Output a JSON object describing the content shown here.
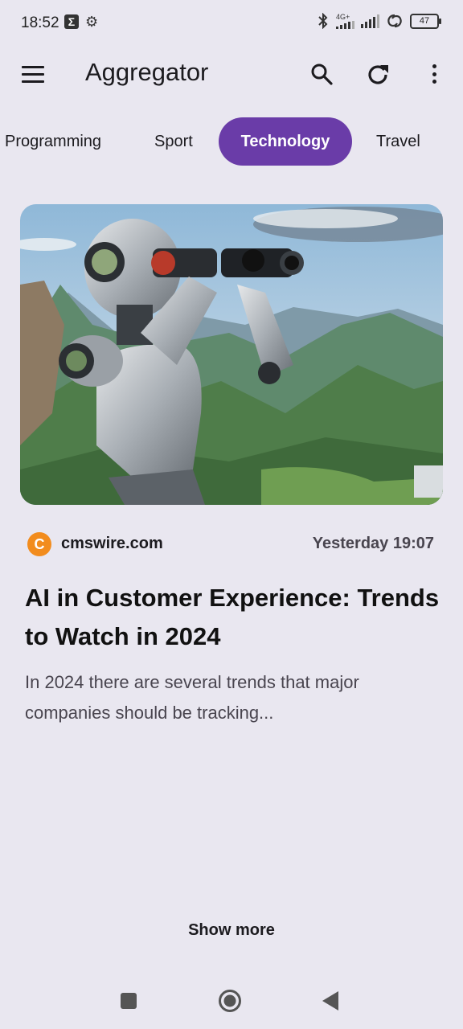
{
  "status_bar": {
    "time": "18:52",
    "network": "4G+",
    "battery": "47"
  },
  "app_bar": {
    "title": "Aggregator",
    "icons": [
      "menu-icon",
      "search-icon",
      "refresh-icon",
      "more-vert-icon"
    ]
  },
  "tabs": [
    {
      "label": "Programming",
      "selected": false
    },
    {
      "label": "Sport",
      "selected": false
    },
    {
      "label": "Technology",
      "selected": true
    },
    {
      "label": "Travel",
      "selected": false
    }
  ],
  "article": {
    "source_icon_letter": "C",
    "source": "cmswire.com",
    "date": "Yesterday 19:07",
    "title": "AI in Customer Experience: Trends to Watch in 2024",
    "summary": "In 2024 there are several trends that major companies should be tracking...",
    "image": "robot-with-binoculars-over-mountains"
  },
  "show_more": "Show more",
  "colors": {
    "accent": "#6a3ca8",
    "background": "#e9e7f0",
    "source_icon": "#f28c1d"
  }
}
